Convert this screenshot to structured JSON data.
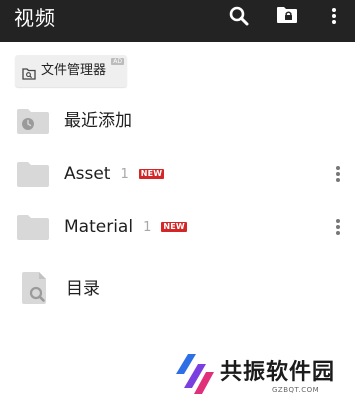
{
  "header": {
    "title": "视频",
    "icons": [
      "search-icon",
      "lock-folder-icon",
      "more-vertical-icon"
    ]
  },
  "chip": {
    "label": "文件管理器",
    "corner_tag": "AD",
    "icon": "folder-search-icon"
  },
  "items": [
    {
      "label": "最近添加",
      "icon": "recent-folder-icon"
    },
    {
      "label": "Asset",
      "count": "1",
      "badge": "NEW",
      "icon": "folder-icon"
    },
    {
      "label": "Material",
      "count": "1",
      "badge": "NEW",
      "icon": "folder-icon"
    },
    {
      "label": "目录",
      "icon": "document-search-icon"
    }
  ],
  "watermark": {
    "text": "共振软件园",
    "url": "GZBQT.COM"
  },
  "colors": {
    "topbar": "#232323",
    "folder": "#d8d8d8",
    "badge": "#d32727",
    "count": "#a8a8a8"
  }
}
